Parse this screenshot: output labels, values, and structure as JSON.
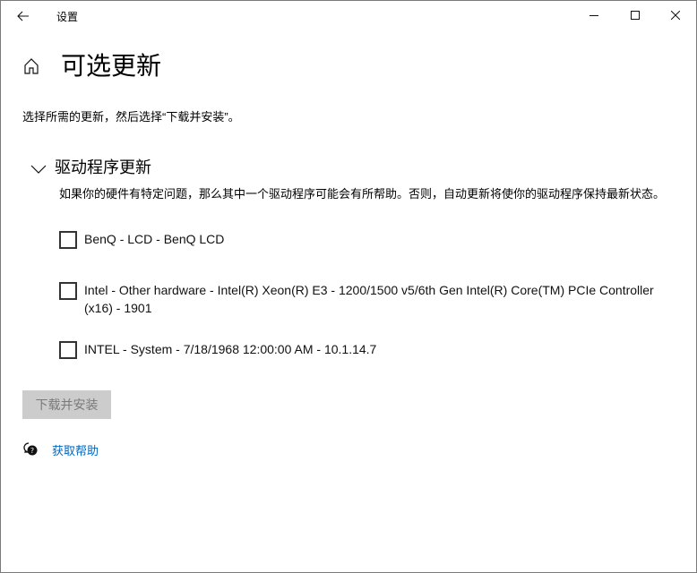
{
  "titlebar": {
    "title": "设置",
    "back_icon": "arrow-left-icon",
    "minimize_icon": "minimize-icon",
    "maximize_icon": "maximize-icon",
    "close_icon": "close-icon"
  },
  "page": {
    "title": "可选更新",
    "home_icon": "home-icon",
    "description": "选择所需的更新，然后选择“下载并安装”。"
  },
  "section": {
    "title": "驱动程序更新",
    "expanded": true,
    "description": "如果你的硬件有特定问题，那么其中一个驱动程序可能会有所帮助。否则，自动更新将使你的驱动程序保持最新状态。",
    "items": [
      {
        "label": "BenQ - LCD - BenQ LCD",
        "checked": false
      },
      {
        "label": "Intel - Other hardware - Intel(R) Xeon(R) E3 - 1200/1500 v5/6th Gen Intel(R) Core(TM) PCIe Controller (x16) - 1901",
        "checked": false
      },
      {
        "label": "INTEL - System - 7/18/1968 12:00:00 AM - 10.1.14.7",
        "checked": false
      }
    ]
  },
  "install_button": {
    "label": "下载并安装",
    "enabled": false
  },
  "help": {
    "label": "获取帮助",
    "icon": "help-chat-icon"
  },
  "colors": {
    "link": "#0067c0",
    "button_disabled_bg": "#cccccc",
    "button_disabled_text": "#7a7a7a"
  }
}
